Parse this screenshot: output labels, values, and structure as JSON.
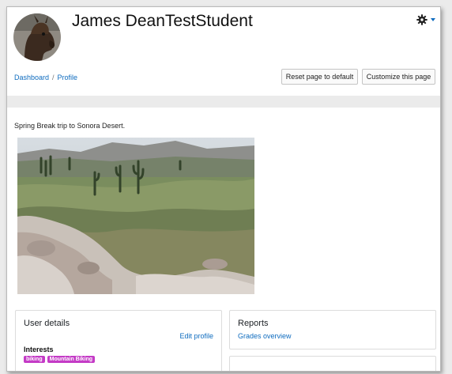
{
  "user": {
    "full_name": "James DeanTestStudent"
  },
  "header": {
    "settings_icon": "gear-icon",
    "accent_color": "#0f6cbf"
  },
  "breadcrumb": {
    "items": [
      "Dashboard",
      "Profile"
    ],
    "separator": "/"
  },
  "buttons": {
    "reset_label": "Reset page to default",
    "customize_label": "Customize this page"
  },
  "profile": {
    "description": "Spring Break trip to Sonora Desert."
  },
  "user_details": {
    "title": "User details",
    "edit_link": "Edit profile",
    "interests_label": "Interests",
    "interests": [
      "biking",
      "Mountain Biking"
    ],
    "tag_color": "#c43bc6"
  },
  "reports": {
    "title": "Reports",
    "links": [
      "Grades overview"
    ]
  }
}
